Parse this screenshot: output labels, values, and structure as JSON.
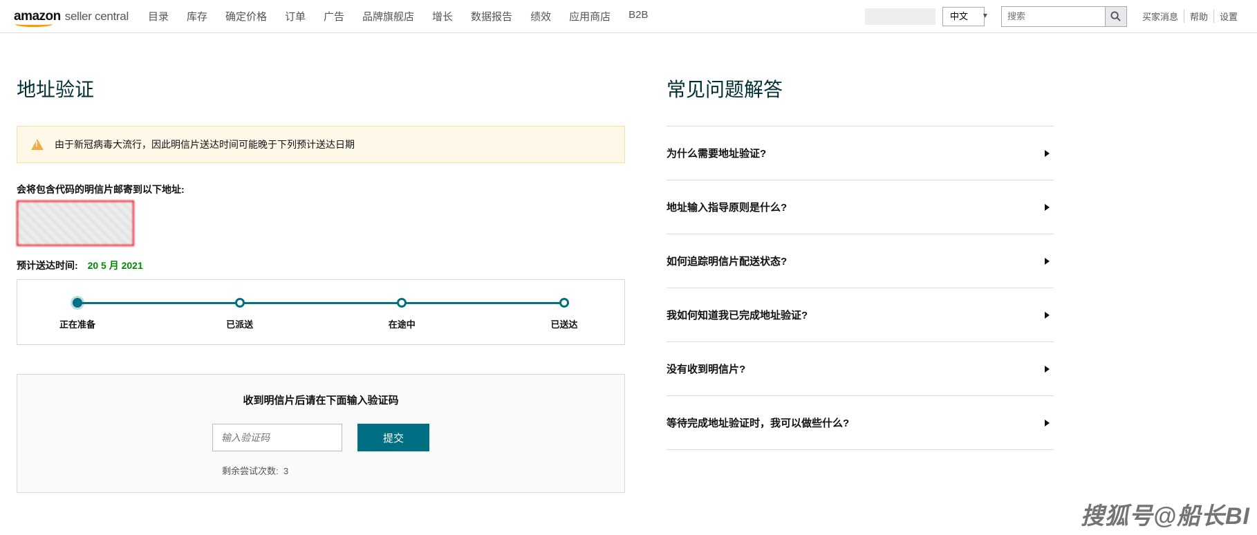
{
  "header": {
    "logo_main": "amazon",
    "logo_sub": "seller central",
    "nav": [
      "目录",
      "库存",
      "确定价格",
      "订单",
      "广告",
      "品牌旗舰店",
      "增长",
      "数据报告",
      "绩效",
      "应用商店",
      "B2B"
    ],
    "lang_selected": "中文",
    "search_placeholder": "搜索",
    "right_links": [
      "买家消息",
      "帮助",
      "设置"
    ]
  },
  "main": {
    "title": "地址验证",
    "alert": "由于新冠病毒大流行，因此明信片送达时间可能晚于下列预计送达日期",
    "addr_label": "会将包含代码的明信片邮寄到以下地址:",
    "eta_label": "预计送达时间:",
    "eta_value": "20 5 月 2021",
    "steps": [
      "正在准备",
      "已派送",
      "在途中",
      "已送达"
    ],
    "code": {
      "title": "收到明信片后请在下面输入验证码",
      "placeholder": "输入验证码",
      "submit": "提交",
      "attempts_label": "剩余尝试次数:",
      "attempts_value": "3"
    }
  },
  "faq": {
    "title": "常见问题解答",
    "items": [
      "为什么需要地址验证?",
      "地址输入指导原则是什么?",
      "如何追踪明信片配送状态?",
      "我如何知道我已完成地址验证?",
      "没有收到明信片?",
      "等待完成地址验证时，我可以做些什么?"
    ]
  },
  "watermark": "搜狐号@船长BI"
}
